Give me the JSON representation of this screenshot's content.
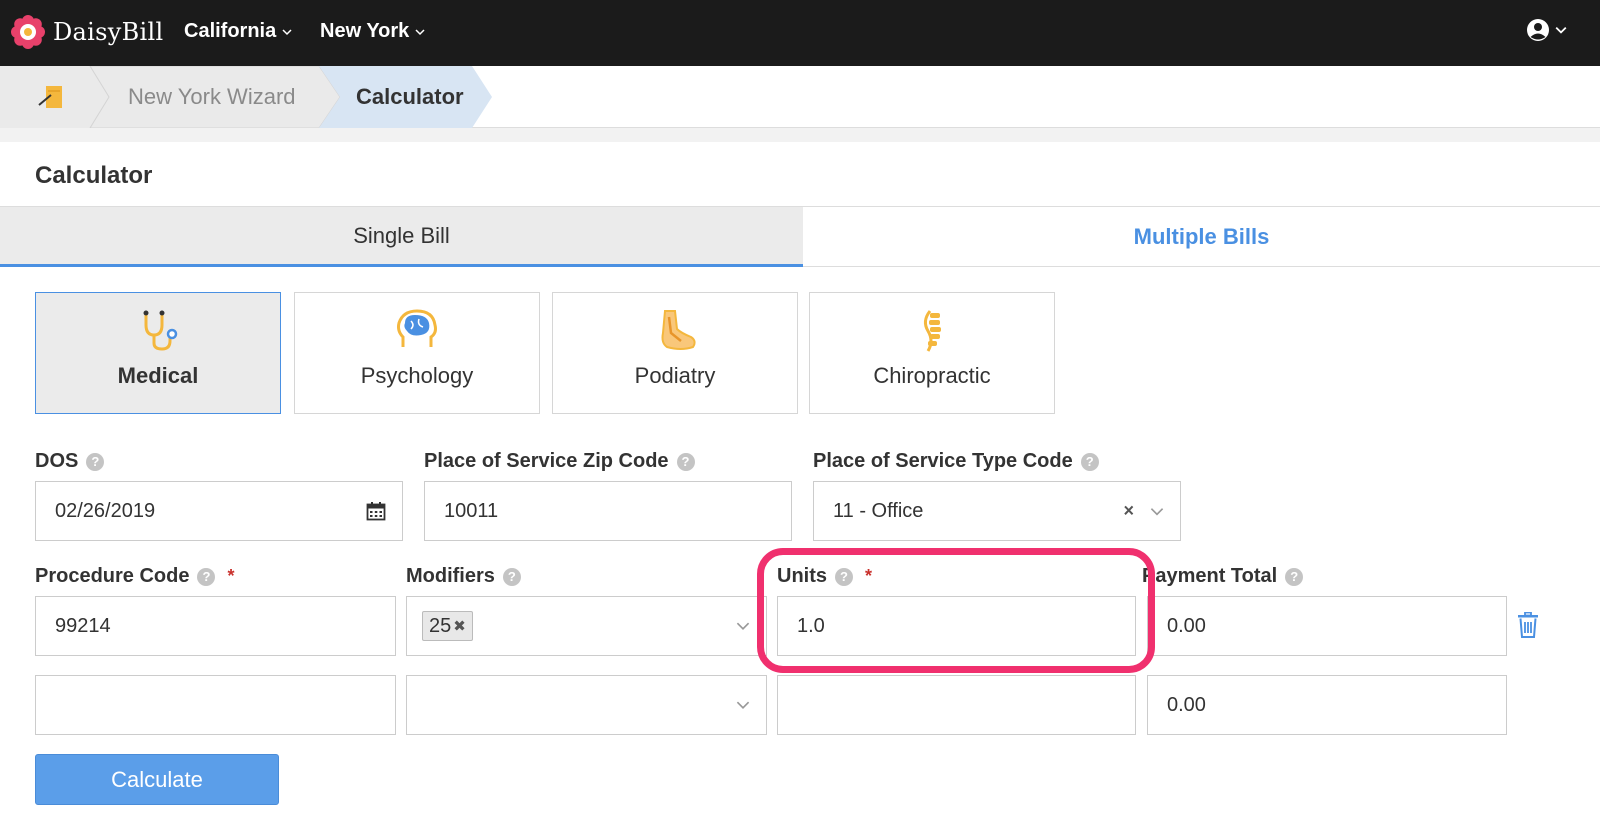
{
  "app": {
    "name": "DaisyBill"
  },
  "nav": {
    "items": [
      {
        "label": "California"
      },
      {
        "label": "New York"
      }
    ]
  },
  "breadcrumb": {
    "items": [
      "New York Wizard",
      "Calculator"
    ]
  },
  "page": {
    "title": "Calculator"
  },
  "tabs": [
    {
      "label": "Single Bill",
      "active": true
    },
    {
      "label": "Multiple Bills",
      "active": false
    }
  ],
  "specialties": [
    {
      "label": "Medical",
      "icon": "stethoscope-icon",
      "active": true
    },
    {
      "label": "Psychology",
      "icon": "brain-icon",
      "active": false
    },
    {
      "label": "Podiatry",
      "icon": "foot-icon",
      "active": false
    },
    {
      "label": "Chiropractic",
      "icon": "spine-icon",
      "active": false
    }
  ],
  "form": {
    "dos": {
      "label": "DOS",
      "value": "02/26/2019"
    },
    "zip": {
      "label": "Place of Service Zip Code",
      "value": "10011"
    },
    "pos_type": {
      "label": "Place of Service Type Code",
      "value": "11 - Office"
    },
    "headers": {
      "procedure": "Procedure Code",
      "modifiers": "Modifiers",
      "units": "Units",
      "payment": "Payment Total",
      "required_mark": "*"
    },
    "rows": [
      {
        "procedure": "99214",
        "modifier_tag": "25",
        "units": "1.0",
        "payment": "0.00"
      },
      {
        "procedure": "",
        "modifier_tag": "",
        "units": "",
        "payment": "0.00"
      }
    ],
    "calculate_label": "Calculate"
  },
  "colors": {
    "accent": "#4a90e2",
    "highlight": "#f0306e",
    "topbar": "#1b1b1b",
    "button": "#5b9ee9"
  }
}
